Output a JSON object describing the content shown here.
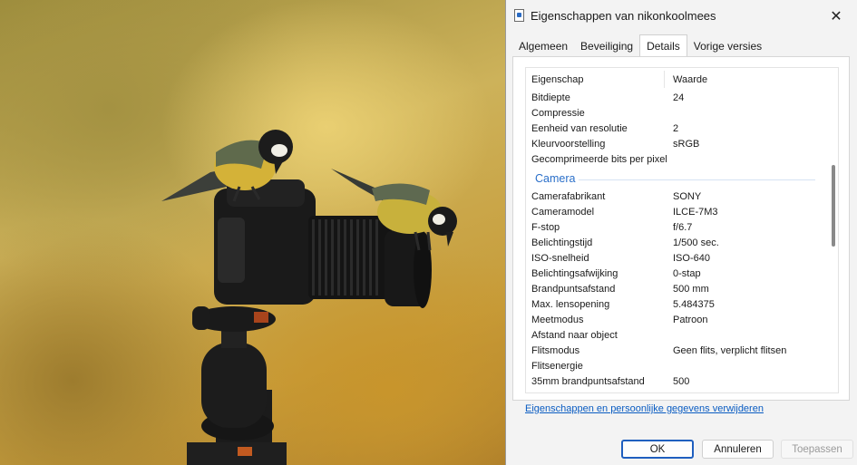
{
  "background": {
    "description_icon": "photo-great-tits-on-camera"
  },
  "dialog": {
    "title": "Eigenschappen van nikonkoolmees",
    "close_symbol": "✕",
    "tabs": [
      {
        "label": "Algemeen",
        "active": false
      },
      {
        "label": "Beveiliging",
        "active": false
      },
      {
        "label": "Details",
        "active": true
      },
      {
        "label": "Vorige versies",
        "active": false
      }
    ],
    "columns": {
      "property": "Eigenschap",
      "value": "Waarde"
    },
    "rows_top": [
      {
        "p": "Bitdiepte",
        "v": "24"
      },
      {
        "p": "Compressie",
        "v": ""
      },
      {
        "p": "Eenheid van resolutie",
        "v": "2"
      },
      {
        "p": "Kleurvoorstelling",
        "v": "sRGB"
      },
      {
        "p": "Gecomprimeerde bits per pixel",
        "v": ""
      }
    ],
    "group_camera": "Camera",
    "rows_camera": [
      {
        "p": "Camerafabrikant",
        "v": "SONY"
      },
      {
        "p": "Cameramodel",
        "v": "ILCE-7M3"
      },
      {
        "p": "F-stop",
        "v": "f/6.7"
      },
      {
        "p": "Belichtingstijd",
        "v": "1/500 sec."
      },
      {
        "p": "ISO-snelheid",
        "v": "ISO-640"
      },
      {
        "p": "Belichtingsafwijking",
        "v": "0-stap"
      },
      {
        "p": "Brandpuntsafstand",
        "v": "500 mm"
      },
      {
        "p": "Max. lensopening",
        "v": "5.484375"
      },
      {
        "p": "Meetmodus",
        "v": "Patroon"
      },
      {
        "p": "Afstand naar object",
        "v": ""
      },
      {
        "p": "Flitsmodus",
        "v": "Geen flits, verplicht flitsen"
      },
      {
        "p": "Flitsenergie",
        "v": ""
      },
      {
        "p": "35mm brandpuntsafstand",
        "v": "500"
      }
    ],
    "link": "Eigenschappen en persoonlijke gegevens verwijderen",
    "buttons": {
      "ok": "OK",
      "cancel": "Annuleren",
      "apply": "Toepassen"
    }
  }
}
